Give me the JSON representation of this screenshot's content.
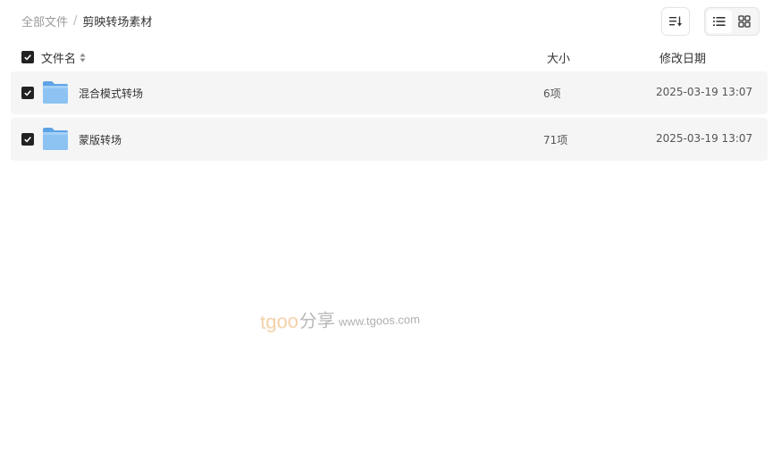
{
  "breadcrumb": {
    "root": "全部文件",
    "separator": "/",
    "current": "剪映转场素材"
  },
  "toolbar": {
    "sort_icon": "sort-list-icon",
    "view_list_icon": "list-view-icon",
    "view_grid_icon": "grid-view-icon",
    "active_view": "list"
  },
  "table": {
    "columns": {
      "name": "文件名",
      "size": "大小",
      "date": "修改日期"
    },
    "rows": [
      {
        "name": "混合模式转场",
        "size": "6项",
        "date": "2025-03-19 13:07",
        "checked": true
      },
      {
        "name": "蒙版转场",
        "size": "71项",
        "date": "2025-03-19 13:07",
        "checked": true
      }
    ]
  },
  "watermark": {
    "brand": "tgoo",
    "cn": "分享",
    "url": "www.tgoos.com"
  },
  "colors": {
    "checkbox": "#222222",
    "row_bg": "#f5f5f5",
    "folder": "#7fb8ee",
    "watermark_brand": "#f3c99a"
  }
}
